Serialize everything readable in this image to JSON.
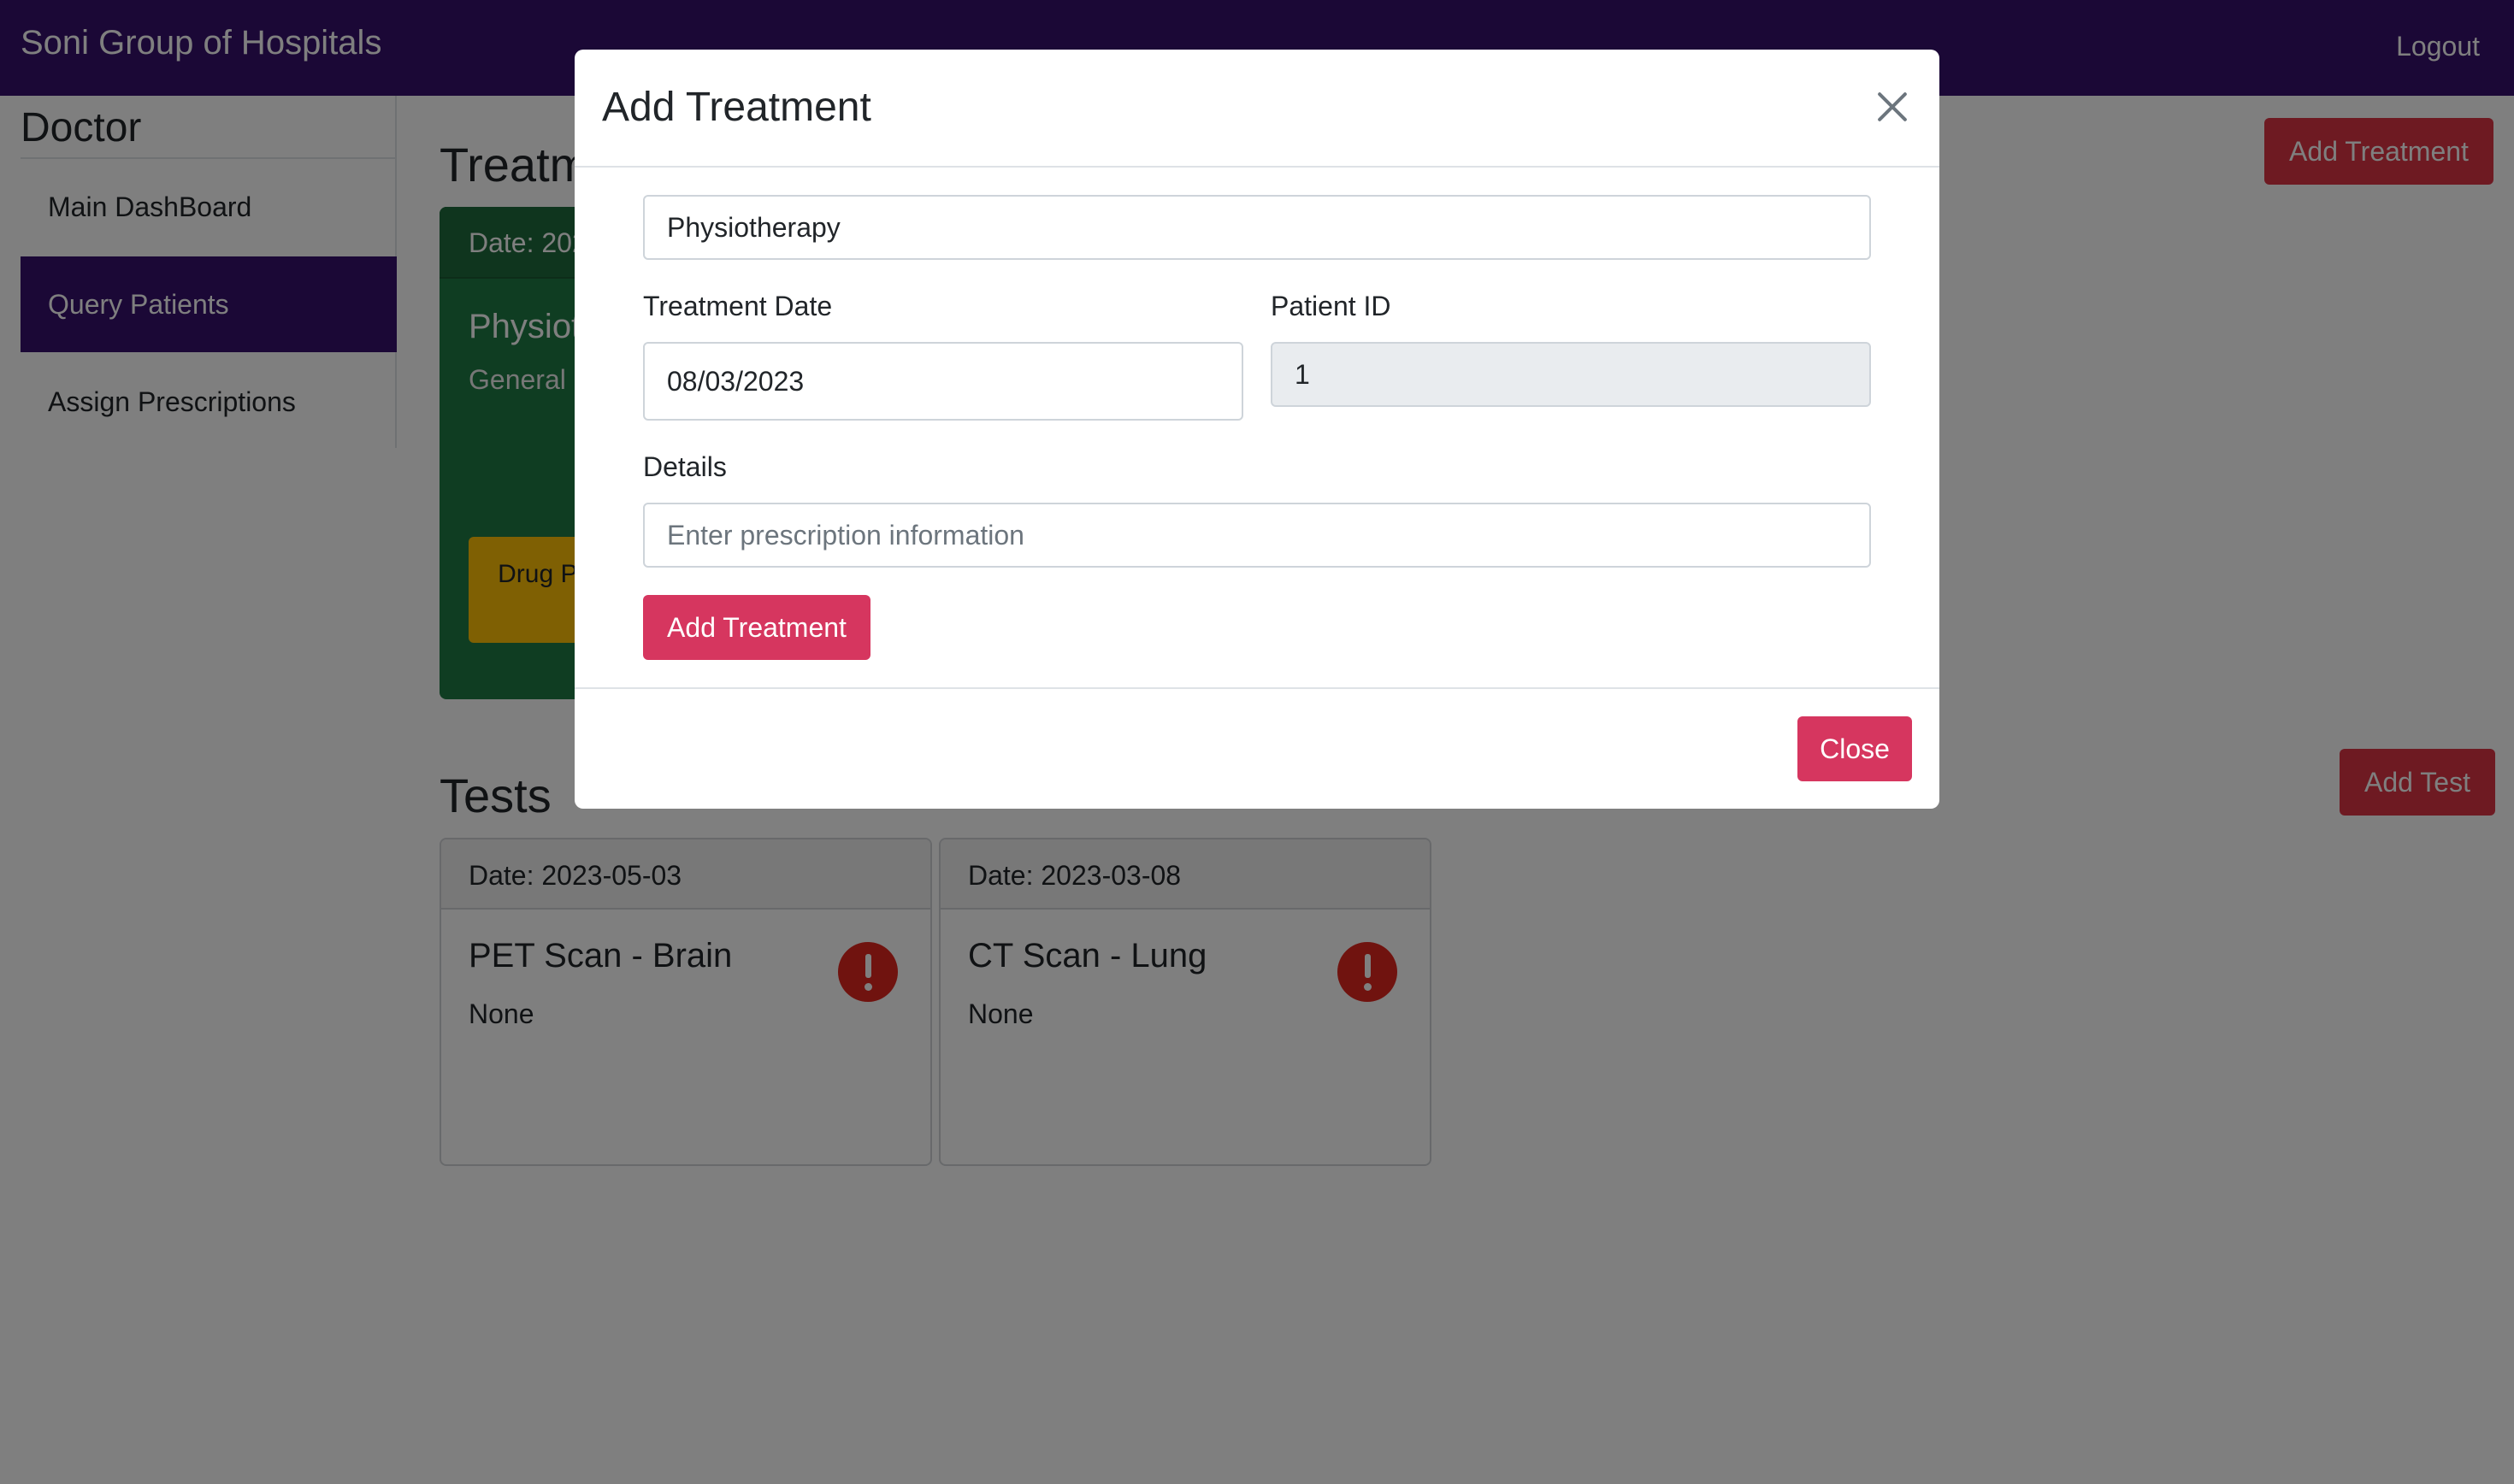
{
  "navbar": {
    "brand": "Soni Group of Hospitals",
    "logout_label": "Logout",
    "color": "#36106c"
  },
  "sidebar": {
    "title": "Doctor",
    "items": [
      {
        "label": "Main DashBoard",
        "active": false
      },
      {
        "label": "Query Patients",
        "active": true
      },
      {
        "label": "Assign Prescriptions",
        "active": false
      }
    ]
  },
  "treatments": {
    "title": "Treatments",
    "add_button_label": "Add Treatment",
    "cards": [
      {
        "date": "Date: 2023-03-08",
        "name": "Physiotherapy",
        "subtitle": "General",
        "drug_button_label": "Drug Prescription"
      }
    ]
  },
  "tests": {
    "title": "Tests",
    "add_button_label": "Add Test",
    "cards": [
      {
        "date": "Date: 2023-05-03",
        "name": "PET Scan - Brain",
        "result": "None",
        "status_icon": "exclamation-circle-icon"
      },
      {
        "date": "Date: 2023-03-08",
        "name": "CT Scan - Lung",
        "result": "None",
        "status_icon": "exclamation-circle-icon"
      }
    ]
  },
  "modal": {
    "title": "Add Treatment",
    "treatment_name_value": "Physiotherapy",
    "treatment_date_label": "Treatment Date",
    "treatment_date_value": "08/03/2023",
    "patient_id_label": "Patient ID",
    "patient_id_value": "1",
    "details_label": "Details",
    "details_placeholder": "Enter prescription information",
    "submit_label": "Add Treatment",
    "close_label": "Close"
  },
  "colors": {
    "brand_purple": "#36106c",
    "danger": "#dc3545",
    "treatment_card": "#1f7a44",
    "warning": "#ffc107"
  }
}
